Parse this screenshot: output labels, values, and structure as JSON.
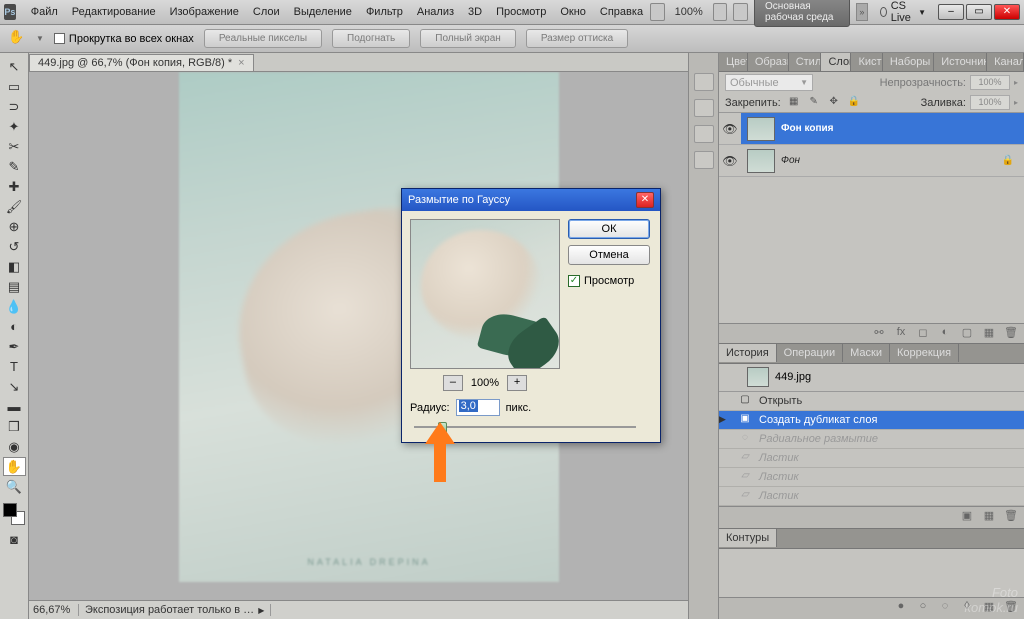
{
  "menubar": {
    "items": [
      "Файл",
      "Редактирование",
      "Изображение",
      "Слои",
      "Выделение",
      "Фильтр",
      "Анализ",
      "3D",
      "Просмотр",
      "Окно",
      "Справка"
    ],
    "zoom": "100%",
    "workspace": "Основная рабочая среда",
    "cslive": "CS Live"
  },
  "options": {
    "scroll_label": "Прокрутка во всех окнах",
    "buttons": [
      "Реальные пикселы",
      "Подогнать",
      "Полный экран",
      "Размер оттиска"
    ]
  },
  "doc": {
    "tab": "449.jpg @ 66,7% (Фон копия, RGB/8) *",
    "watermark": "NATALIA DREPINA"
  },
  "status": {
    "zoom": "66,67%",
    "info": "Экспозиция работает только в …"
  },
  "panels": {
    "color_tabs": [
      "Цвет",
      "Образцы",
      "Стили",
      "Слои",
      "Кисти",
      "Наборы кист",
      "Источник кло",
      "Каналы"
    ],
    "layers": {
      "mode_label": "Обычные",
      "opacity_label": "Непрозрачность:",
      "opacity": "100%",
      "lock_label": "Закрепить:",
      "fill_label": "Заливка:",
      "fill": "100%",
      "rows": [
        {
          "name": "Фон копия",
          "sel": true,
          "locked": false
        },
        {
          "name": "Фон",
          "sel": false,
          "locked": true
        }
      ]
    },
    "hist_tabs": [
      "История",
      "Операции",
      "Маски",
      "Коррекция"
    ],
    "history": {
      "doc": "449.jpg",
      "rows": [
        {
          "label": "Открыть",
          "sel": false,
          "dim": false
        },
        {
          "label": "Создать дубликат слоя",
          "sel": true,
          "dim": false
        },
        {
          "label": "Радиальное размытие",
          "sel": false,
          "dim": true
        },
        {
          "label": "Ластик",
          "sel": false,
          "dim": true
        },
        {
          "label": "Ластик",
          "sel": false,
          "dim": true
        },
        {
          "label": "Ластик",
          "sel": false,
          "dim": true
        }
      ]
    },
    "paths_tab": "Контуры"
  },
  "dialog": {
    "title": "Размытие по Гауссу",
    "ok": "ОК",
    "cancel": "Отмена",
    "preview": "Просмотр",
    "zoom": "100%",
    "radius_label": "Радиус:",
    "radius_value": "3,0",
    "radius_unit": "пикс."
  },
  "watermark_site": "Foto\nkomok.ru"
}
